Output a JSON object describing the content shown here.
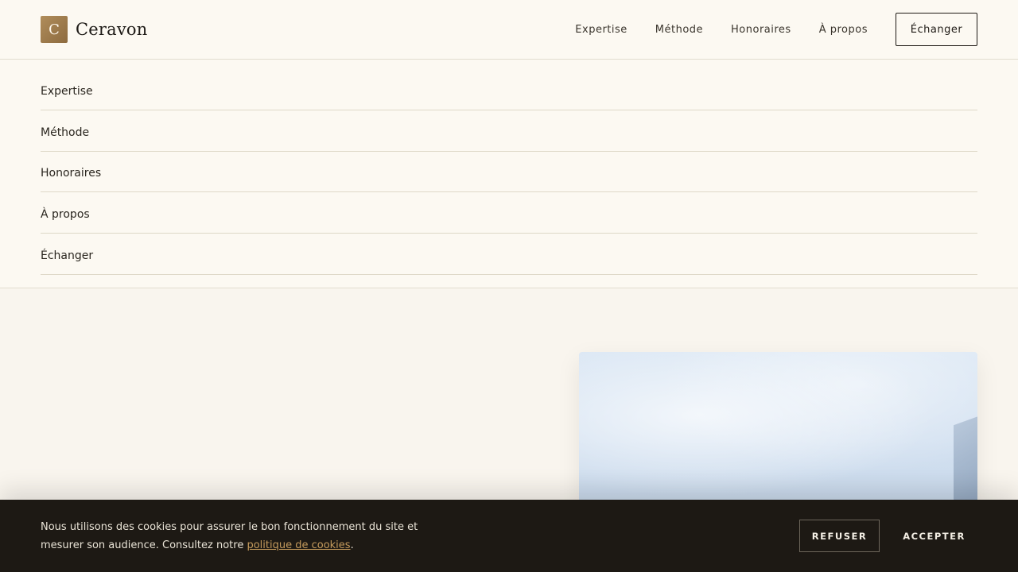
{
  "brand": {
    "logo_letter": "C",
    "name": "Ceravon",
    "accent_color": "#a07d4c"
  },
  "header": {
    "nav": [
      {
        "label": "Expertise"
      },
      {
        "label": "Méthode"
      },
      {
        "label": "Honoraires"
      },
      {
        "label": "À propos"
      }
    ],
    "cta_label": "Échanger"
  },
  "menu": {
    "items": [
      {
        "label": "Expertise"
      },
      {
        "label": "Méthode"
      },
      {
        "label": "Honoraires"
      },
      {
        "label": "À propos"
      },
      {
        "label": "Échanger"
      }
    ]
  },
  "cookie_banner": {
    "text_before": "Nous utilisons des cookies pour assurer le bon fonctionnement du site et mesurer son audience. Consultez notre ",
    "link_label": "politique de cookies",
    "text_after": ".",
    "refuse_label": "REFUSER",
    "accept_label": "ACCEPTER",
    "background_color": "#1d1914"
  }
}
